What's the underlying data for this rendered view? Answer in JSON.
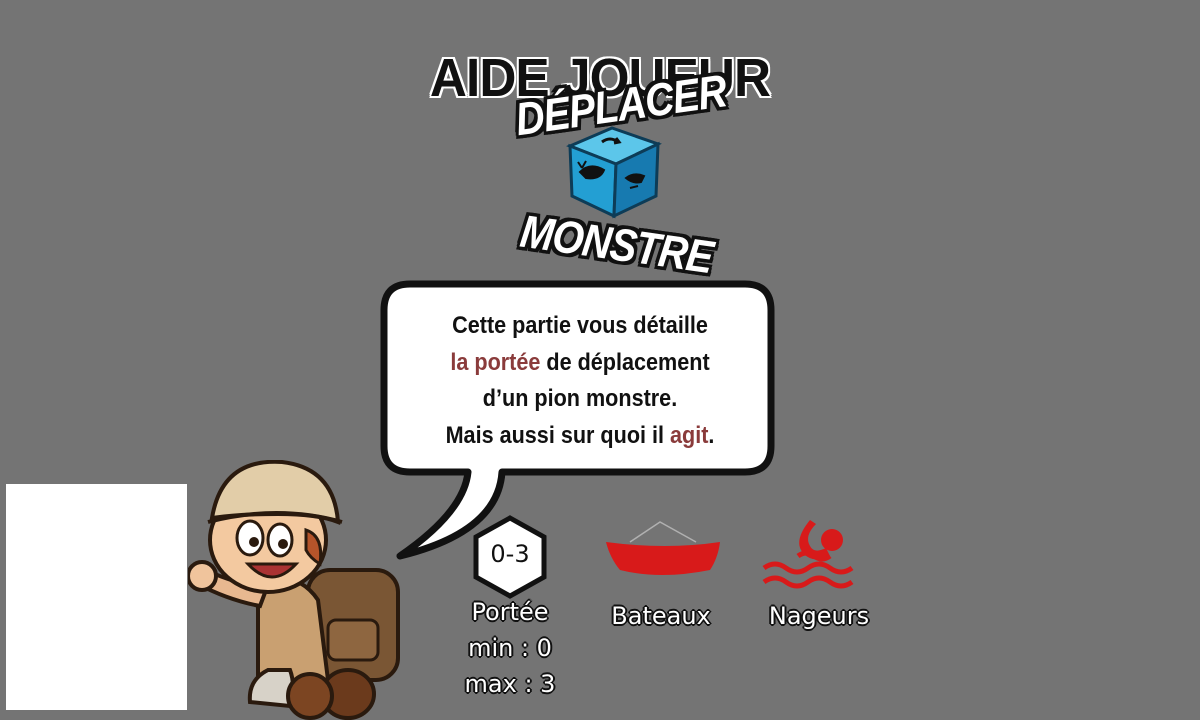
{
  "title": "AIDE JOUEUR",
  "die_labels": {
    "top": "DÉPLACER",
    "bottom": "MONSTRE"
  },
  "bubble": {
    "line1": "Cette partie vous détaille",
    "line2_highlight": "la portée",
    "line2_rest": " de déplacement",
    "line3": "d’un pion monstre.",
    "line4_start": "Mais aussi sur quoi il ",
    "line4_highlight": "agit",
    "line4_end": "."
  },
  "range_token": {
    "value": "0-3"
  },
  "legend": {
    "range": {
      "label": "Portée",
      "min": "min : 0",
      "max": "max : 3"
    },
    "boats": {
      "label": "Bateaux",
      "icon": "boat-icon"
    },
    "swimmers": {
      "label": "Nageurs",
      "icon": "swimmer-icon"
    }
  },
  "colors": {
    "background": "#747474",
    "accent": "#8a3b3b",
    "target_red": "#d81a1a",
    "die_blue": "#2aa8d8"
  }
}
